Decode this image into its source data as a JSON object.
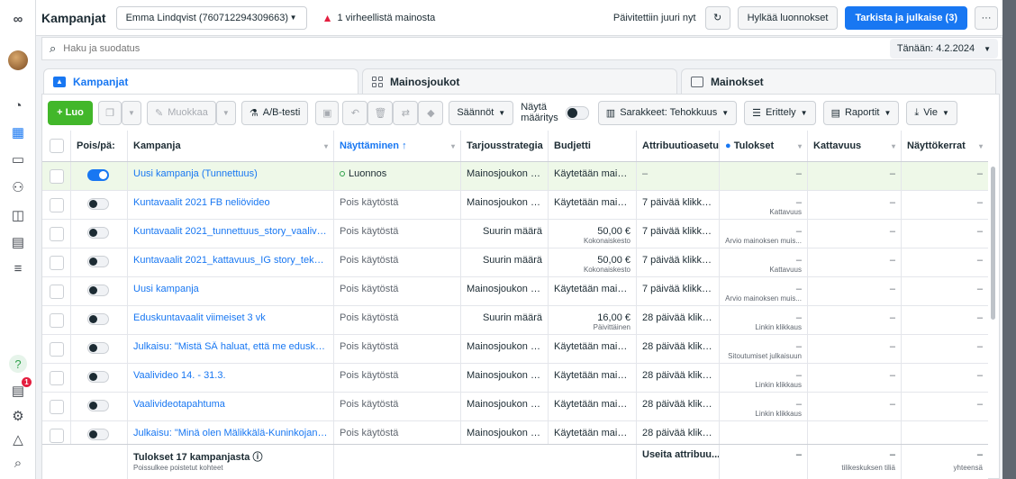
{
  "app": {
    "title": "Kampanjat",
    "account_selector": "Emma Lindqvist (760712294309663)",
    "warning_text": "1 virheellistä mainosta",
    "updated_text": "Päivitettiin juuri nyt",
    "discard_label": "Hylkää luonnokset",
    "publish_label": "Tarkista ja julkaise (3)",
    "more_label": "···"
  },
  "sidebar": {
    "logo": "∞",
    "help": "?",
    "notification_count": "1",
    "icons": [
      "meta-logo-icon",
      "avatar",
      "dashboard-icon",
      "campaigns-table-icon",
      "pages-icon",
      "audiences-icon",
      "catalog-icon",
      "reports-icon",
      "menu-icon",
      "help-icon",
      "notifications-icon",
      "settings-icon",
      "alerts-bell-icon",
      "search-icon"
    ]
  },
  "search": {
    "placeholder": "Haku ja suodatus",
    "date": "Tänään: 4.2.2024"
  },
  "tabs": [
    {
      "label": "Kampanjat",
      "active": true
    },
    {
      "label": "Mainosjoukot",
      "active": false
    },
    {
      "label": "Mainokset",
      "active": false
    }
  ],
  "toolbar": {
    "create": "+ Luo",
    "edit": "Muokkaa",
    "ab_test": "A/B-testi",
    "rules": "Säännöt",
    "show_label_1": "Näytä",
    "show_label_2": "määritys",
    "columns": "Sarakkeet: Tehokkuus",
    "breakdown": "Erittely",
    "reports": "Raportit",
    "export": "Vie"
  },
  "table": {
    "headers": [
      "Pois/pä:",
      "Kampanja",
      "Näyttäminen ↑",
      "Tarjousstrategia",
      "Budjetti",
      "Attribuutioasetu",
      "Tulokset",
      "Kattavuus",
      "Näyttökerrat"
    ],
    "rows": [
      {
        "on": true,
        "name": "Uusi kampanja (Tunnettuus)",
        "delivery": "Luonnos",
        "delivery_draft": true,
        "bid": "Mainosjoukon ta...",
        "budget": "Käytetään maino...",
        "budget_sub": "",
        "attr": "–",
        "results": "–",
        "results_sub": "",
        "reach": "–",
        "impr": "–"
      },
      {
        "on": false,
        "name": "Kuntavaalit 2021 FB neliövideo",
        "delivery": "Pois käytöstä",
        "bid": "Mainosjoukon ta...",
        "budget": "Käytetään maino...",
        "budget_sub": "",
        "attr": "7 päivää klikka...",
        "results": "–",
        "results_sub": "Kattavuus",
        "reach": "–",
        "impr": "–"
      },
      {
        "on": false,
        "name": "Kuntavaalit 2021_tunnettuus_story_vaalivideo",
        "delivery": "Pois käytöstä",
        "bid": "Suurin määrä",
        "budget": "50,00 €",
        "budget_sub": "Kokonaiskesto",
        "attr": "7 päivää klikka...",
        "results": "–",
        "results_sub": "Arvio mainoksen muis...",
        "reach": "–",
        "impr": "–"
      },
      {
        "on": false,
        "name": "Kuntavaalit 2021_kattavuus_IG story_tekstivideo",
        "delivery": "Pois käytöstä",
        "bid": "Suurin määrä",
        "budget": "50,00 €",
        "budget_sub": "Kokonaiskesto",
        "attr": "7 päivää klikka...",
        "results": "–",
        "results_sub": "Kattavuus",
        "reach": "–",
        "impr": "–"
      },
      {
        "on": false,
        "name": "Uusi kampanja",
        "delivery": "Pois käytöstä",
        "bid": "Mainosjoukon ta...",
        "budget": "Käytetään maino...",
        "budget_sub": "",
        "attr": "7 päivää klikka...",
        "results": "–",
        "results_sub": "Arvio mainoksen muis...",
        "reach": "–",
        "impr": "–"
      },
      {
        "on": false,
        "name": "Eduskuntavaalit viimeiset 3 vk",
        "delivery": "Pois käytöstä",
        "bid": "Suurin määrä",
        "budget": "16,00 €",
        "budget_sub": "Päivittäinen",
        "attr": "28 päivää klikk...",
        "results": "–",
        "results_sub": "Linkin klikkaus",
        "reach": "–",
        "impr": "–"
      },
      {
        "on": false,
        "name": "Julkaisu: \"Mistä SÄ haluat, että me eduskuntav...",
        "delivery": "Pois käytöstä",
        "bid": "Mainosjoukon ta...",
        "budget": "Käytetään maino...",
        "budget_sub": "",
        "attr": "28 päivää klikk...",
        "results": "–",
        "results_sub": "Sitoutumiset julkaisuun",
        "reach": "–",
        "impr": "–"
      },
      {
        "on": false,
        "name": "Vaalivideo 14. - 31.3.",
        "delivery": "Pois käytöstä",
        "bid": "Mainosjoukon ta...",
        "budget": "Käytetään maino...",
        "budget_sub": "",
        "attr": "28 päivää klikk...",
        "results": "–",
        "results_sub": "Linkin klikkaus",
        "reach": "–",
        "impr": "–"
      },
      {
        "on": false,
        "name": "Vaalivideotapahtuma",
        "delivery": "Pois käytöstä",
        "bid": "Mainosjoukon ta...",
        "budget": "Käytetään maino...",
        "budget_sub": "",
        "attr": "28 päivää klikk...",
        "results": "–",
        "results_sub": "Linkin klikkaus",
        "reach": "–",
        "impr": "–"
      },
      {
        "on": false,
        "name": "Julkaisu: \"Minä olen Mälikkälä-Kuninkojan...\"",
        "delivery": "Pois käytöstä",
        "bid": "Mainosjoukon ta...",
        "budget": "Käytetään maino...",
        "budget_sub": "",
        "attr": "28 päivää klikk...",
        "results": "",
        "results_sub": "",
        "reach": "",
        "impr": ""
      }
    ],
    "footer": {
      "title": "Tulokset 17 kampanjasta",
      "subtitle": "Poissulkee poistetut kohteet",
      "attr": "Useita attribuu...",
      "results": "–",
      "reach": "–",
      "reach_sub": "tilikeskuksen tiliä",
      "impr": "–",
      "impr_sub": "yhteensä"
    }
  }
}
